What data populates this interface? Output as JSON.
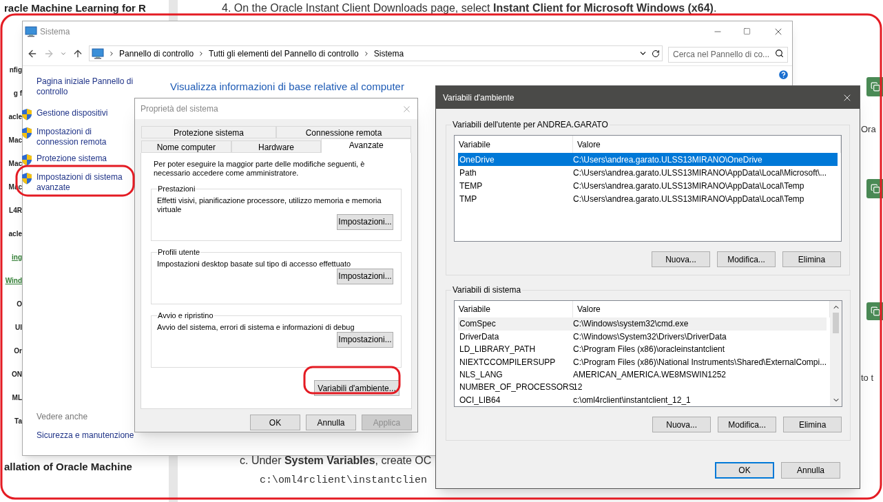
{
  "doc_page": {
    "step_text": "4. On the Oracle Instant Client Downloads page, select **Instant Client for Microsoft Windows (x64)**.",
    "nav_title": "racle Machine Learning for R",
    "nav_items": [
      {
        "label": "nfig",
        "kind": "heading"
      },
      {
        "label": "g f",
        "kind": "heading"
      },
      {
        "label": "acle",
        "kind": "heading"
      },
      {
        "label": "Mac",
        "kind": "heading"
      },
      {
        "label": "Mac",
        "kind": "heading"
      },
      {
        "label": "Mac",
        "kind": "heading"
      },
      {
        "label": "L4R",
        "kind": "heading"
      },
      {
        "label": "acle",
        "kind": "heading"
      },
      {
        "label": "ing",
        "kind": "link"
      },
      {
        "label": "Wind",
        "kind": "link"
      },
      {
        "label": "O",
        "kind": "heading"
      },
      {
        "label": "UI",
        "kind": "heading"
      },
      {
        "label": "Or",
        "kind": "heading"
      },
      {
        "label": "ON",
        "kind": "heading"
      },
      {
        "label": "ML",
        "kind": "heading"
      },
      {
        "label": "Ta",
        "kind": "heading"
      }
    ],
    "nav_bottom": "allation of Oracle Machine",
    "right_fragments": [
      "Ora",
      "to t"
    ],
    "bottom_step": "c. Under **System Variables**, create OC",
    "code_line": "c:\\oml4rclient\\instantclien"
  },
  "sistema_window": {
    "title": "Sistema",
    "breadcrumbs": [
      "Pannello di controllo",
      "Tutti gli elementi del Pannello di controllo",
      "Sistema"
    ],
    "search": {
      "placeholder": "Cerca nel Pannello di co..."
    },
    "home_link": "Pagina iniziale Pannello di controllo",
    "tasks": [
      {
        "label": "Gestione dispositivi"
      },
      {
        "label": "Impostazioni di connession remota"
      },
      {
        "label": "Protezione sistema"
      },
      {
        "label": "Impostazioni di sistema avanzate"
      }
    ],
    "see_also_title": "Vedere anche",
    "see_also": [
      "Sicurezza e manutenzione"
    ],
    "heading": "Visualizza informazioni di base relative al computer"
  },
  "system_properties_dialog": {
    "title": "Proprietà del sistema",
    "tab_rows": [
      {
        "tabs": [
          {
            "label": "Protezione sistema",
            "selected": false
          },
          {
            "label": "Connessione remota",
            "selected": false
          }
        ]
      },
      {
        "tabs": [
          {
            "label": "Nome computer",
            "selected": false
          },
          {
            "label": "Hardware",
            "selected": false
          },
          {
            "label": "Avanzate",
            "selected": true
          }
        ]
      }
    ],
    "note": "Per poter eseguire la maggior parte delle modifiche seguenti, è necessario accedere come amministratore.",
    "groups": [
      {
        "title": "Prestazioni",
        "description": "Effetti visivi, pianificazione processore, utilizzo memoria e memoria virtuale",
        "button": "Impostazioni..."
      },
      {
        "title": "Profili utente",
        "description": "Impostazioni desktop basate sul tipo di accesso effettuato",
        "button": "Impostazioni..."
      },
      {
        "title": "Avvio e ripristino",
        "description": "Avvio del sistema, errori di sistema e informazioni di debug",
        "button": "Impostazioni..."
      }
    ],
    "env_button": "Variabili d'ambiente...",
    "buttons": [
      {
        "label": "OK",
        "disabled": false
      },
      {
        "label": "Annulla",
        "disabled": false
      },
      {
        "label": "Applica",
        "disabled": true
      }
    ]
  },
  "environment_variables_dialog": {
    "title": "Variabili d'ambiente",
    "sections": [
      {
        "title": "Variabili dell'utente per ANDREA.GARATO",
        "focused": true,
        "scrollbar": false,
        "columns": [
          "Variabile",
          "Valore"
        ],
        "rows": [
          {
            "variable": "OneDrive",
            "value": "C:\\Users\\andrea.garato.ULSS13MIRANO\\OneDrive",
            "selected": true
          },
          {
            "variable": "Path",
            "value": "C:\\Users\\andrea.garato.ULSS13MIRANO\\AppData\\Local\\Microsoft\\...",
            "selected": false
          },
          {
            "variable": "TEMP",
            "value": "C:\\Users\\andrea.garato.ULSS13MIRANO\\AppData\\Local\\Temp",
            "selected": false
          },
          {
            "variable": "TMP",
            "value": "C:\\Users\\andrea.garato.ULSS13MIRANO\\AppData\\Local\\Temp",
            "selected": false
          }
        ],
        "buttons": [
          "Nuova...",
          "Modifica...",
          "Elimina"
        ]
      },
      {
        "title": "Variabili di sistema",
        "focused": false,
        "scrollbar": true,
        "columns": [
          "Variabile",
          "Valore"
        ],
        "rows": [
          {
            "variable": "ComSpec",
            "value": "C:\\Windows\\system32\\cmd.exe",
            "selected": true
          },
          {
            "variable": "DriverData",
            "value": "C:\\Windows\\System32\\Drivers\\DriverData",
            "selected": false
          },
          {
            "variable": "LD_LIBRARY_PATH",
            "value": "C:\\Program Files (x86)\\oracleinstantclient",
            "selected": false
          },
          {
            "variable": "NIEXTCCOMPILERSUPP",
            "value": "C:\\Program Files (x86)\\National Instruments\\Shared\\ExternalCompi...",
            "selected": false
          },
          {
            "variable": "NLS_LANG",
            "value": "AMERICAN_AMERICA.WE8MSWIN1252",
            "selected": false
          },
          {
            "variable": "NUMBER_OF_PROCESSORS",
            "value": "12",
            "selected": false
          },
          {
            "variable": "OCI_LIB64",
            "value": "c:\\oml4rclient\\instantclient_12_1",
            "selected": false
          }
        ],
        "buttons": [
          "Nuova...",
          "Modifica...",
          "Elimina"
        ]
      }
    ],
    "buttons": [
      {
        "label": "OK",
        "default": true
      },
      {
        "label": "Annulla",
        "default": false
      }
    ]
  }
}
